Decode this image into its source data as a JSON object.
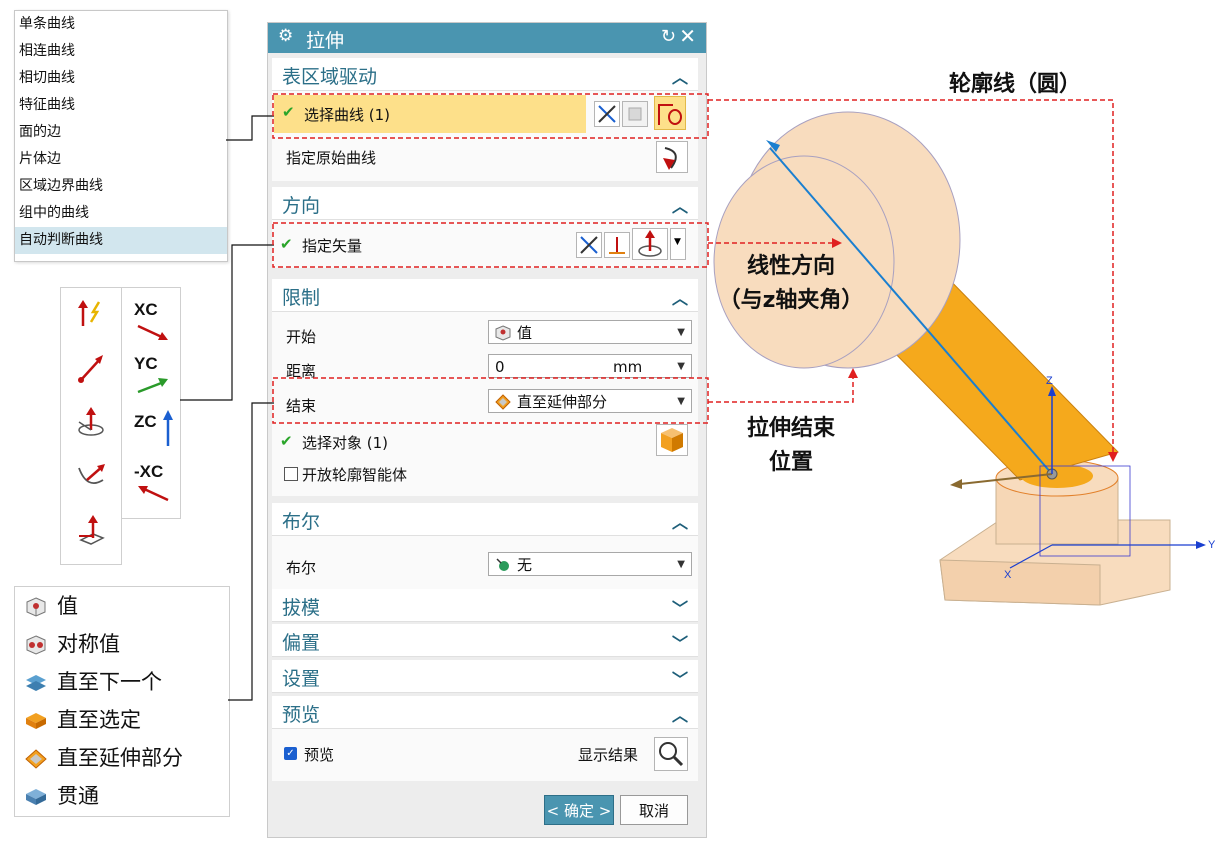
{
  "curve_menu": {
    "items": [
      "单条曲线",
      "相连曲线",
      "相切曲线",
      "特征曲线",
      "面的边",
      "片体边",
      "区域边界曲线",
      "组中的曲线",
      "自动判断曲线"
    ],
    "selected_index": 8
  },
  "vector_tools": [
    "inferred-vector-icon",
    "two-points-icon",
    "normal-vector-icon",
    "curve-tangent-icon",
    "plane-normal-icon"
  ],
  "axis_tools": {
    "labels": [
      "XC",
      "YC",
      "ZC",
      "-XC"
    ]
  },
  "limit_types": [
    "值",
    "对称值",
    "直至下一个",
    "直至选定",
    "直至延伸部分",
    "贯通"
  ],
  "dialog": {
    "title": "拉伸",
    "sections": {
      "section": "表区域驱动",
      "select_curve": "选择曲线 (1)",
      "specify_original": "指定原始曲线",
      "direction": "方向",
      "specify_vector": "指定矢量",
      "limits": "限制",
      "start_label": "开始",
      "start_value": "值",
      "distance_label": "距离",
      "distance_value": "0",
      "distance_unit": "mm",
      "end_label": "结束",
      "end_value": "直至延伸部分",
      "select_object": "选择对象 (1)",
      "open_profile": "开放轮廓智能体",
      "boolean": "布尔",
      "boolean_label": "布尔",
      "boolean_value": "无",
      "draft": "拔模",
      "offset": "偏置",
      "settings": "设置",
      "preview": "预览",
      "preview_check": "预览",
      "show_result": "显示结果"
    },
    "ok": "< 确定 >",
    "cancel": "取消"
  },
  "callouts": {
    "profile": "轮廓线（圆）",
    "direction_l1": "线性方向",
    "direction_l2": "（与z轴夹角）",
    "end_l1": "拉伸结束",
    "end_l2": "位置"
  },
  "axes": {
    "z": "Z",
    "y": "Y",
    "x": "X"
  },
  "colors": {
    "title_bar": "#4a95b0",
    "highlight": "#fde08a",
    "callout_red": "#e02020",
    "ok_button": "#4a95b0",
    "cylinder": "#f5a91c",
    "disc": "#f8dcbe"
  }
}
